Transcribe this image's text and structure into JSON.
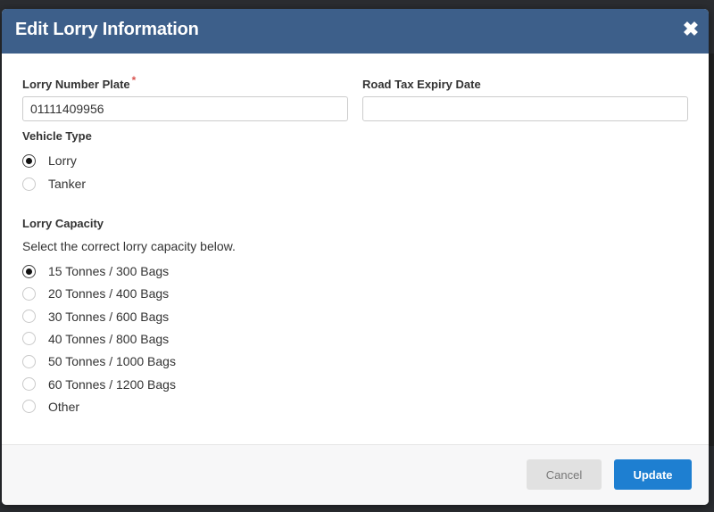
{
  "modal": {
    "title": "Edit Lorry Information",
    "close_icon": "close-icon"
  },
  "form": {
    "plate": {
      "label": "Lorry Number Plate",
      "required_mark": "*",
      "value": "01111409956",
      "placeholder": ""
    },
    "road_tax": {
      "label": "Road Tax Expiry Date",
      "value": "",
      "placeholder": ""
    },
    "vehicle_type": {
      "label": "Vehicle Type",
      "selected": "Lorry",
      "options": [
        "Lorry",
        "Tanker"
      ]
    },
    "capacity": {
      "label": "Lorry Capacity",
      "help": "Select the correct lorry capacity below.",
      "selected": "15 Tonnes / 300 Bags",
      "options": [
        "15 Tonnes / 300 Bags",
        "20 Tonnes / 400 Bags",
        "30 Tonnes / 600 Bags",
        "40 Tonnes / 800 Bags",
        "50 Tonnes / 1000 Bags",
        "60 Tonnes / 1200 Bags",
        "Other"
      ]
    }
  },
  "footer": {
    "cancel_label": "Cancel",
    "update_label": "Update"
  },
  "colors": {
    "header": "#3d5f8a",
    "primary_button": "#1e7fd1",
    "required": "#d9534f"
  }
}
